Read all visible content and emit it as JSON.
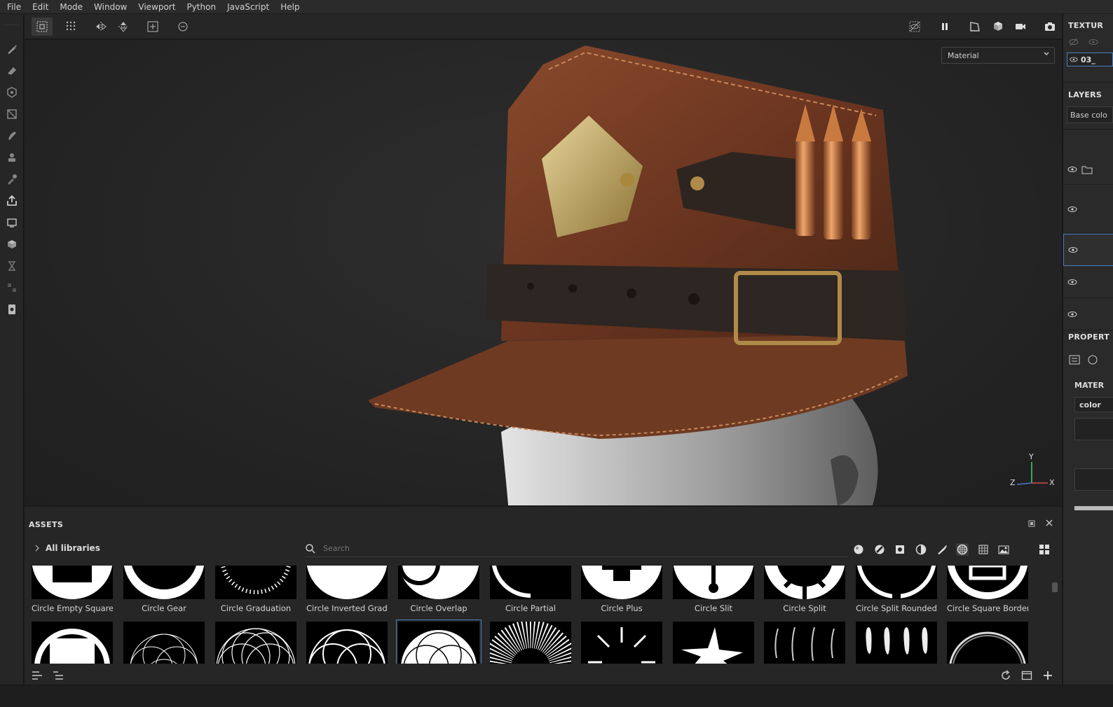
{
  "menu": [
    "File",
    "Edit",
    "Mode",
    "Window",
    "Viewport",
    "Python",
    "JavaScript",
    "Help"
  ],
  "viewport": {
    "material_select": "Material",
    "gizmo": {
      "y": "Y",
      "z": "Z",
      "x": "X"
    }
  },
  "right_panel": {
    "texture_title": "TEXTUR",
    "texture_set": "03_",
    "layers_title": "LAYERS",
    "layers_channel": "Base colo",
    "properties_title": "PROPERT",
    "material_title": "MATER",
    "material_field": "color"
  },
  "assets": {
    "title": "ASSETS",
    "library": "All libraries",
    "search_placeholder": "Search",
    "row1": [
      "Circle Empty Square",
      "Circle Gear",
      "Circle Graduation",
      "Circle Inverted Gradi...",
      "Circle Overlap",
      "Circle Partial",
      "Circle Plus",
      "Circle Slit",
      "Circle Split",
      "Circle Split Rounded",
      "Circle Square Border"
    ]
  },
  "colors": {
    "accent": "#4a80c0",
    "panel": "#262626",
    "viewport": "#232323",
    "leather": "#7a3f25"
  }
}
